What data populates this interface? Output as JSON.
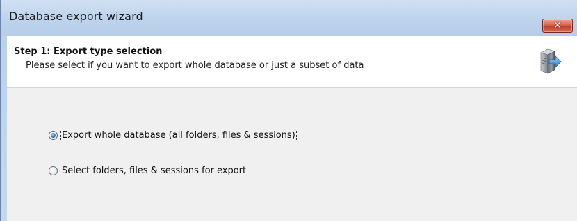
{
  "window": {
    "title": "Database export wizard",
    "close_symbol": "✕"
  },
  "header": {
    "step_title": "Step 1: Export type selection",
    "step_description": "Please select if you want to export whole database or just a subset of data",
    "icon": "server-export-icon"
  },
  "options": [
    {
      "label": "Export whole database (all folders, files & sessions)",
      "selected": true
    },
    {
      "label": "Select folders, files & sessions for export",
      "selected": false
    }
  ],
  "colors": {
    "titlebar": "#bdd3ec",
    "close_button": "#c94a34",
    "panel": "#f0f0f0",
    "radio_dot": "#2d7fc4"
  }
}
